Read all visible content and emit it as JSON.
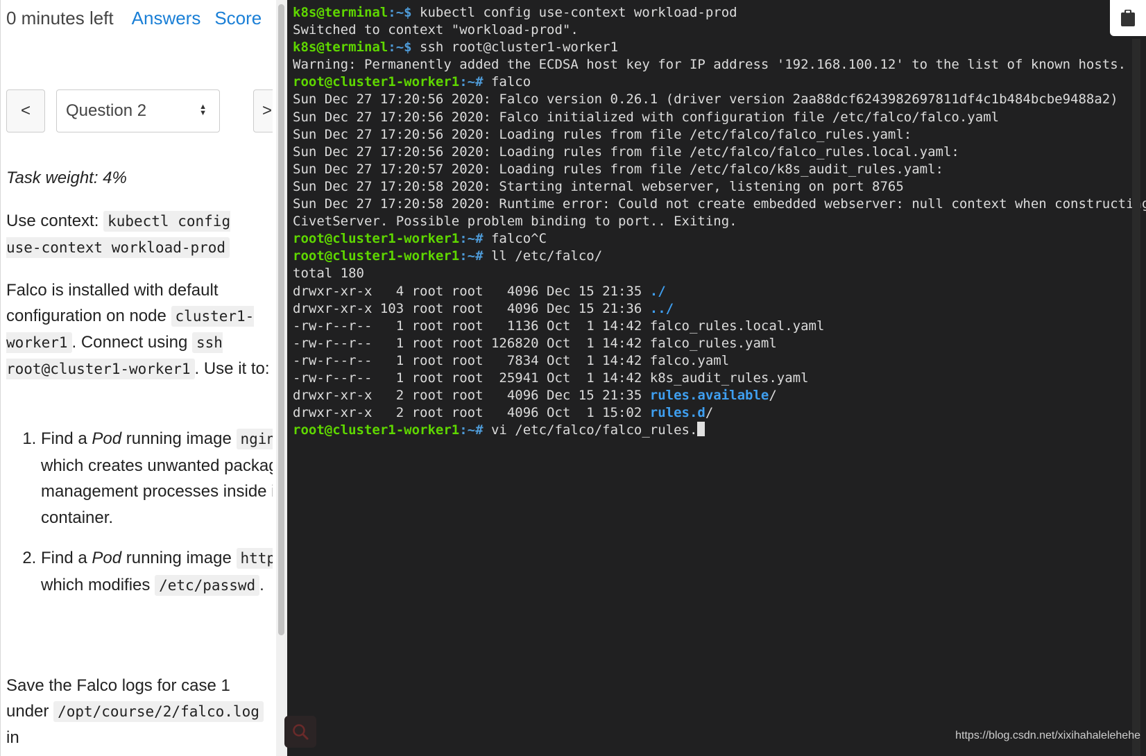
{
  "header": {
    "time_left": "0 minutes left",
    "answers_link": "Answers",
    "score_link": "Score"
  },
  "navigation": {
    "prev_label": "<",
    "next_label": ">",
    "question_select": "Question 2"
  },
  "task": {
    "weight": "Task weight: 4%",
    "context_label": "Use context:",
    "context_command": "kubectl config use-context workload-prod",
    "intro_1": "Falco is installed with default configuration on node",
    "node_name": "cluster1-worker1",
    "intro_2": ". Connect using",
    "ssh_command": "ssh root@cluster1-worker1",
    "intro_3": ". Use it to:",
    "steps": [
      {
        "a": "Find a ",
        "b": "Pod",
        "c": " running image ",
        "code": "nginx",
        "d": " which creates unwanted package management processes inside its container.",
        "e": ""
      },
      {
        "a": "Find a ",
        "b": "Pod",
        "c": " running image ",
        "code": "httpd",
        "d": " which modifies ",
        "code2": "/etc/passwd",
        "e": "."
      }
    ],
    "save_text": "Save the Falco logs for case 1 under",
    "save_path": "/opt/course/2/falco.log",
    "save_tail": " in"
  },
  "terminal": {
    "lines": [
      [
        {
          "t": "k8s@terminal",
          "c": "pc"
        },
        {
          "t": ":~$ ",
          "c": "pp"
        },
        {
          "t": "kubectl config use-context workload-prod"
        }
      ],
      [
        {
          "t": "Switched to context \"workload-prod\"."
        }
      ],
      [
        {
          "t": "k8s@terminal",
          "c": "pc"
        },
        {
          "t": ":~$ ",
          "c": "pp"
        },
        {
          "t": "ssh root@cluster1-worker1"
        }
      ],
      [
        {
          "t": "Warning: Permanently added the ECDSA host key for IP address '192.168.100.12' to the list of known hosts."
        }
      ],
      [
        {
          "t": "root@cluster1-worker1",
          "c": "pc"
        },
        {
          "t": ":~# ",
          "c": "pp"
        },
        {
          "t": "falco"
        }
      ],
      [
        {
          "t": "Sun Dec 27 17:20:56 2020: Falco version 0.26.1 (driver version 2aa88dcf6243982697811df4c1b484bcbe9488a2)"
        }
      ],
      [
        {
          "t": "Sun Dec 27 17:20:56 2020: Falco initialized with configuration file /etc/falco/falco.yaml"
        }
      ],
      [
        {
          "t": "Sun Dec 27 17:20:56 2020: Loading rules from file /etc/falco/falco_rules.yaml:"
        }
      ],
      [
        {
          "t": "Sun Dec 27 17:20:56 2020: Loading rules from file /etc/falco/falco_rules.local.yaml:"
        }
      ],
      [
        {
          "t": "Sun Dec 27 17:20:57 2020: Loading rules from file /etc/falco/k8s_audit_rules.yaml:"
        }
      ],
      [
        {
          "t": "Sun Dec 27 17:20:58 2020: Starting internal webserver, listening on port 8765"
        }
      ],
      [
        {
          "t": "Sun Dec 27 17:20:58 2020: Runtime error: Could not create embedded webserver: null context when constructing"
        }
      ],
      [
        {
          "t": "CivetServer. Possible problem binding to port.. Exiting."
        }
      ],
      [
        {
          "t": "root@cluster1-worker1",
          "c": "pc"
        },
        {
          "t": ":~# ",
          "c": "pp"
        },
        {
          "t": "falco^C"
        }
      ],
      [
        {
          "t": "root@cluster1-worker1",
          "c": "pc"
        },
        {
          "t": ":~# ",
          "c": "pp"
        },
        {
          "t": "ll /etc/falco/"
        }
      ],
      [
        {
          "t": "total 180"
        }
      ],
      [
        {
          "t": "drwxr-xr-x   4 root root   4096 Dec 15 21:35 "
        },
        {
          "t": "./",
          "c": "dir"
        }
      ],
      [
        {
          "t": "drwxr-xr-x 103 root root   4096 Dec 15 21:36 "
        },
        {
          "t": "../",
          "c": "dir"
        }
      ],
      [
        {
          "t": "-rw-r--r--   1 root root   1136 Oct  1 14:42 falco_rules.local.yaml"
        }
      ],
      [
        {
          "t": "-rw-r--r--   1 root root 126820 Oct  1 14:42 falco_rules.yaml"
        }
      ],
      [
        {
          "t": "-rw-r--r--   1 root root   7834 Oct  1 14:42 falco.yaml"
        }
      ],
      [
        {
          "t": "-rw-r--r--   1 root root  25941 Oct  1 14:42 k8s_audit_rules.yaml"
        }
      ],
      [
        {
          "t": "drwxr-xr-x   2 root root   4096 Dec 15 21:35 "
        },
        {
          "t": "rules.available",
          "c": "dir"
        },
        {
          "t": "/"
        }
      ],
      [
        {
          "t": "drwxr-xr-x   2 root root   4096 Oct  1 15:02 "
        },
        {
          "t": "rules.d",
          "c": "dir"
        },
        {
          "t": "/"
        }
      ],
      [
        {
          "t": "root@cluster1-worker1",
          "c": "pc"
        },
        {
          "t": ":~# ",
          "c": "pp"
        },
        {
          "t": "vi /etc/falco/falco_rules."
        },
        {
          "t": "",
          "c": "cursor"
        }
      ]
    ]
  },
  "icons": {
    "clipboard": "clipboard-icon",
    "search": "search-icon"
  },
  "colors": {
    "link": "#1a7fd6",
    "terminal_bg": "#202021",
    "prompt_user": "#5fd700",
    "prompt_path": "#4e9bd8",
    "directory": "#3f9ff0"
  },
  "watermark": "https://blog.csdn.net/xixihahalelehehe"
}
